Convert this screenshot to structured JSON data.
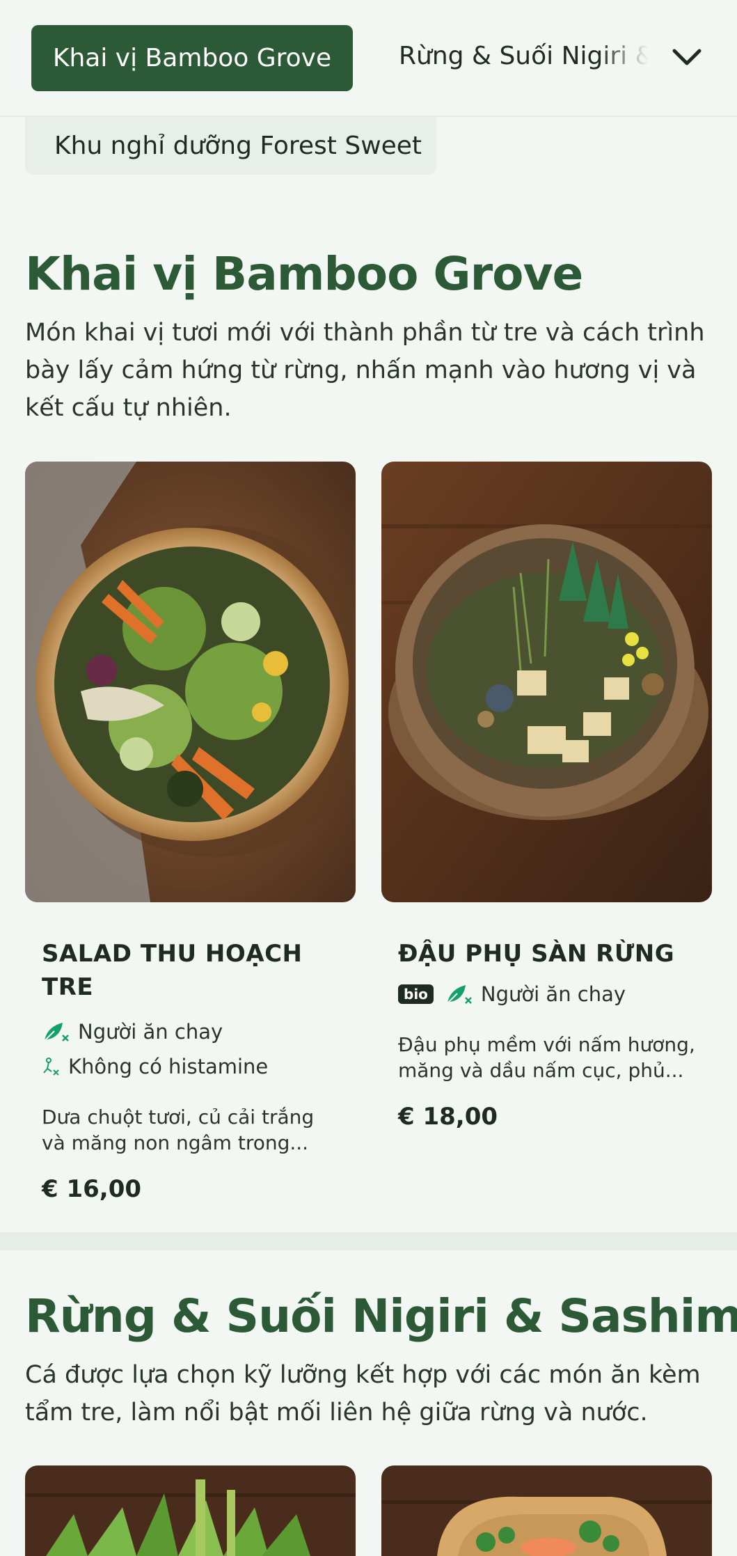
{
  "categories": {
    "active": "Khai vị Bamboo Grove",
    "second": "Rừng & Suối Nigiri & Sashimi",
    "third": "Khu nghỉ dưỡng Forest Sweet"
  },
  "sections": [
    {
      "title": "Khai vị Bamboo Grove",
      "description": "Món khai vị tươi mới với thành phần từ tre và cách trình bày lấy cảm hứng từ rừng, nhấn mạnh vào hương vị và kết cấu tự nhiên.",
      "dishes": [
        {
          "name": "SALAD THU HOẠCH TRE",
          "tags": [
            "Người ăn chay",
            "Không có histamine"
          ],
          "description": "Dưa chuột tươi, củ cải trắng và măng non ngâm trong...",
          "price": "€ 16,00"
        },
        {
          "name": "ĐẬU PHỤ SÀN RỪNG",
          "badge": "bio",
          "tags": [
            "Người ăn chay"
          ],
          "description": "Đậu phụ mềm với nấm hương, măng và dầu nấm cục, phủ...",
          "price": "€ 18,00"
        }
      ]
    },
    {
      "title": "Rừng & Suối Nigiri & Sashimi",
      "description": "Cá được lựa chọn kỹ lưỡng kết hợp với các món ăn kèm tẩm tre, làm nổi bật mối liên hệ giữa rừng và nước."
    }
  ],
  "icons": {
    "vegetarian": "vegetarian-leaf-icon",
    "histamine": "histamine-free-icon",
    "chevron": "chevron-down-icon"
  },
  "colors": {
    "accent": "#2d5a36",
    "icon_green": "#14a06a",
    "background": "#f3f7f3"
  }
}
